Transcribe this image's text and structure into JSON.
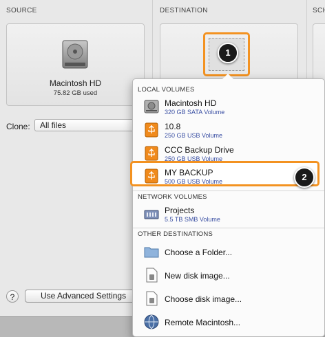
{
  "columns": {
    "source": "SOURCE",
    "destination": "DESTINATION",
    "schedule": "SCH"
  },
  "source": {
    "name": "Macintosh HD",
    "size": "75.82 GB used"
  },
  "clone": {
    "label": "Clone:",
    "value": "All files"
  },
  "advanced_button": "Use Advanced Settings",
  "help": "?",
  "callouts": {
    "one": "1",
    "two": "2"
  },
  "menu": {
    "local_volumes_header": "LOCAL VOLUMES",
    "local_volumes": [
      {
        "name": "Macintosh HD",
        "detail": "320 GB SATA Volume",
        "icon": "internal-disk-icon"
      },
      {
        "name": "10.8",
        "detail": "250 GB USB Volume",
        "icon": "usb-drive-icon"
      },
      {
        "name": "CCC Backup Drive",
        "detail": "250 GB USB Volume",
        "icon": "usb-drive-icon"
      },
      {
        "name": "MY BACKUP",
        "detail": "500 GB USB Volume",
        "icon": "usb-drive-icon"
      }
    ],
    "network_volumes_header": "NETWORK VOLUMES",
    "network_volumes": [
      {
        "name": "Projects",
        "detail": "5.5 TB SMB Volume",
        "icon": "network-volume-icon"
      }
    ],
    "other_destinations_header": "OTHER DESTINATIONS",
    "other_destinations": [
      {
        "name": "Choose a Folder...",
        "icon": "folder-icon"
      },
      {
        "name": "New disk image...",
        "icon": "disk-image-icon"
      },
      {
        "name": "Choose disk image...",
        "icon": "disk-image-icon"
      },
      {
        "name": "Remote Macintosh...",
        "icon": "remote-mac-icon"
      }
    ]
  },
  "colors": {
    "callout_orange": "#f39221",
    "detail_blue": "#3a4fa3"
  }
}
